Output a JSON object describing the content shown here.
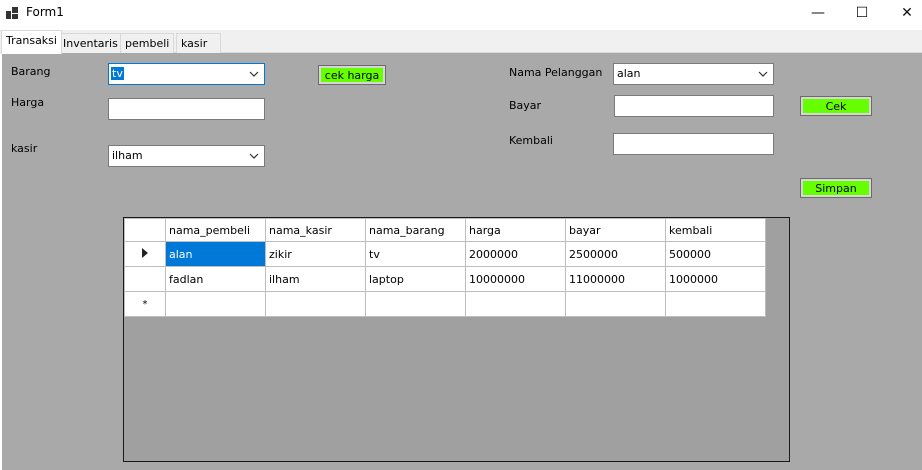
{
  "window": {
    "title": "Form1",
    "min_glyph": "—",
    "max_glyph": "☐",
    "close_glyph": "✕"
  },
  "tabs": [
    {
      "label": "Transaksi"
    },
    {
      "label": "Inventaris"
    },
    {
      "label": "pembeli"
    },
    {
      "label": "kasir"
    }
  ],
  "form": {
    "barang": {
      "label": "Barang",
      "value": "tv"
    },
    "harga": {
      "label": "Harga",
      "value": ""
    },
    "kasir": {
      "label": "kasir",
      "value": "ilham"
    },
    "cek_harga_label": "cek harga",
    "nama_pelanggan": {
      "label": "Nama Pelanggan",
      "value": "alan"
    },
    "bayar": {
      "label": "Bayar",
      "value": ""
    },
    "kembali": {
      "label": "Kembali",
      "value": ""
    },
    "cek_label": "Cek",
    "simpan_label": "Simpan"
  },
  "table": {
    "columns": [
      "nama_pembeli",
      "nama_kasir",
      "nama_barang",
      "harga",
      "bayar",
      "kembali"
    ],
    "rows": [
      [
        "alan",
        "zikir",
        "tv",
        "2000000",
        "2500000",
        "500000"
      ],
      [
        "fadlan",
        "ilham",
        "laptop",
        "10000000",
        "11000000",
        "1000000"
      ]
    ],
    "new_row_marker": "*"
  },
  "colors": {
    "button_green": "#66ff00",
    "panel_gray": "#a9a9a9",
    "selection_blue": "#0078d7"
  }
}
